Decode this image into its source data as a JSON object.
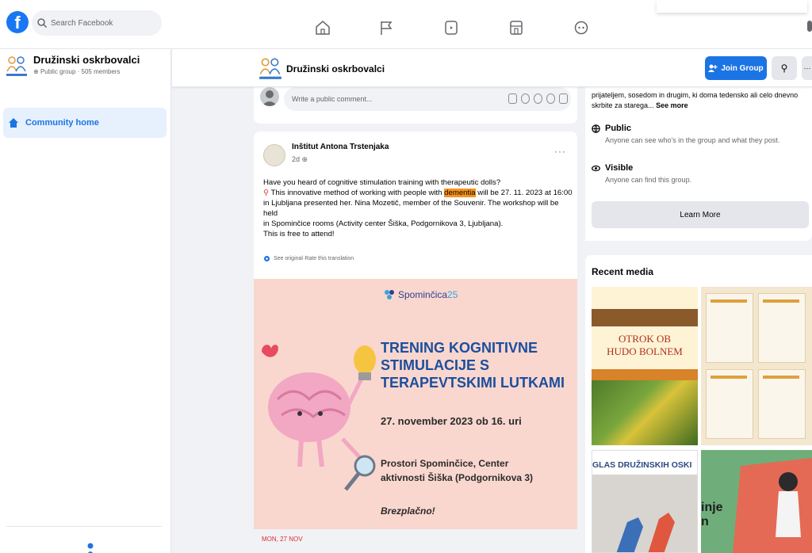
{
  "topnav": {
    "logo_letter": "f",
    "search_placeholder": "Search Facebook",
    "nav_icons": [
      "home-icon",
      "flag-icon",
      "watch-icon",
      "marketplace-icon",
      "gaming-icon"
    ]
  },
  "sidebar": {
    "group_name": "Družinski oskrbovalci",
    "group_meta": "Public group · 505 members",
    "items": [
      {
        "label": "Community home"
      }
    ]
  },
  "subheader": {
    "group_name": "Družinski oskrbovalci",
    "join_label": "Join Group",
    "search_glyph": "⚲",
    "more_glyph": "···"
  },
  "comment_box": {
    "placeholder": "Write a public comment..."
  },
  "post": {
    "author": "Inštitut Antona Trstenjaka",
    "time": "2d",
    "more_glyph": "···",
    "line1": "Have you heard of cognitive stimulation training with therapeutic dolls?",
    "line2_a": "This innovative method of working with people with ",
    "line2_hl": "dementia",
    "line2_b": " will be 27. 11. 2023 at 16:00",
    "line3": "in Ljubljana presented her. Nina Mozetič, member of the Souvenir. The workshop will be held",
    "line4": "in Spominčice rooms (Activity center Šiška, Podgornikova 3, Ljubljana).",
    "line5": "This is free to attend!",
    "see_original": "See original",
    "rate_translation": "Rate this translation",
    "poster": {
      "logo_text": "Spominčica",
      "logo_num": "25",
      "title_l1": "TRENING KOGNITIVNE",
      "title_l2": "STIMULACIJE S",
      "title_l3": "TERAPEVTSKIMI LUTKAMI",
      "date": "27. november 2023 ob 16. uri",
      "place_l1": "Prostori Spominčice, Center",
      "place_l2": "aktivnosti Šiška (Podgornikova 3)",
      "free": "Brezplačno!"
    },
    "event_day": "MON, 27 NOV"
  },
  "about": {
    "snippet_l1": "prijateljem, sosedom in drugim, ki doma tedensko ali celo dnevno",
    "snippet_l2": "skrbite za starega...",
    "see_more": "See more",
    "public_title": "Public",
    "public_desc": "Anyone can see who's in the group and what they post.",
    "visible_title": "Visible",
    "visible_desc": "Anyone can find this group.",
    "learn_more": "Learn More"
  },
  "media": {
    "title": "Recent media",
    "tile1_l1": "OTROK OB",
    "tile1_l2": "HUDO BOLNEM",
    "tile3_title": "GLAS DRUŽINSKIH OSKI",
    "tile4_l1": "inje",
    "tile4_l2": "n"
  },
  "colors": {
    "brand_blue": "#1877f2",
    "join_blue": "#1b74e4",
    "highlight": "#f7931e",
    "poster_bg": "#f9d7cf",
    "poster_title": "#1c4e9c"
  }
}
